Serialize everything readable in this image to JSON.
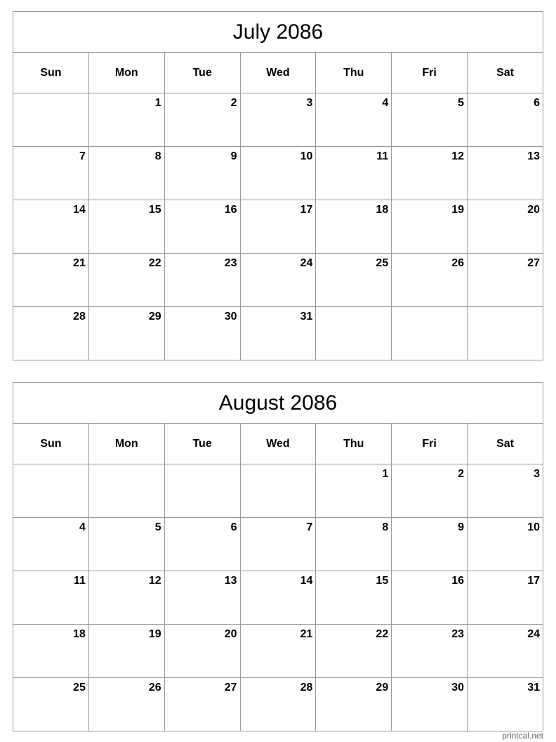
{
  "days_of_week": [
    "Sun",
    "Mon",
    "Tue",
    "Wed",
    "Thu",
    "Fri",
    "Sat"
  ],
  "calendars": [
    {
      "title": "July 2086",
      "weeks": [
        [
          "",
          "1",
          "2",
          "3",
          "4",
          "5",
          "6"
        ],
        [
          "7",
          "8",
          "9",
          "10",
          "11",
          "12",
          "13"
        ],
        [
          "14",
          "15",
          "16",
          "17",
          "18",
          "19",
          "20"
        ],
        [
          "21",
          "22",
          "23",
          "24",
          "25",
          "26",
          "27"
        ],
        [
          "28",
          "29",
          "30",
          "31",
          "",
          "",
          ""
        ]
      ]
    },
    {
      "title": "August 2086",
      "weeks": [
        [
          "",
          "",
          "",
          "",
          "1",
          "2",
          "3"
        ],
        [
          "4",
          "5",
          "6",
          "7",
          "8",
          "9",
          "10"
        ],
        [
          "11",
          "12",
          "13",
          "14",
          "15",
          "16",
          "17"
        ],
        [
          "18",
          "19",
          "20",
          "21",
          "22",
          "23",
          "24"
        ],
        [
          "25",
          "26",
          "27",
          "28",
          "29",
          "30",
          "31"
        ]
      ]
    }
  ],
  "footer": "printcal.net"
}
